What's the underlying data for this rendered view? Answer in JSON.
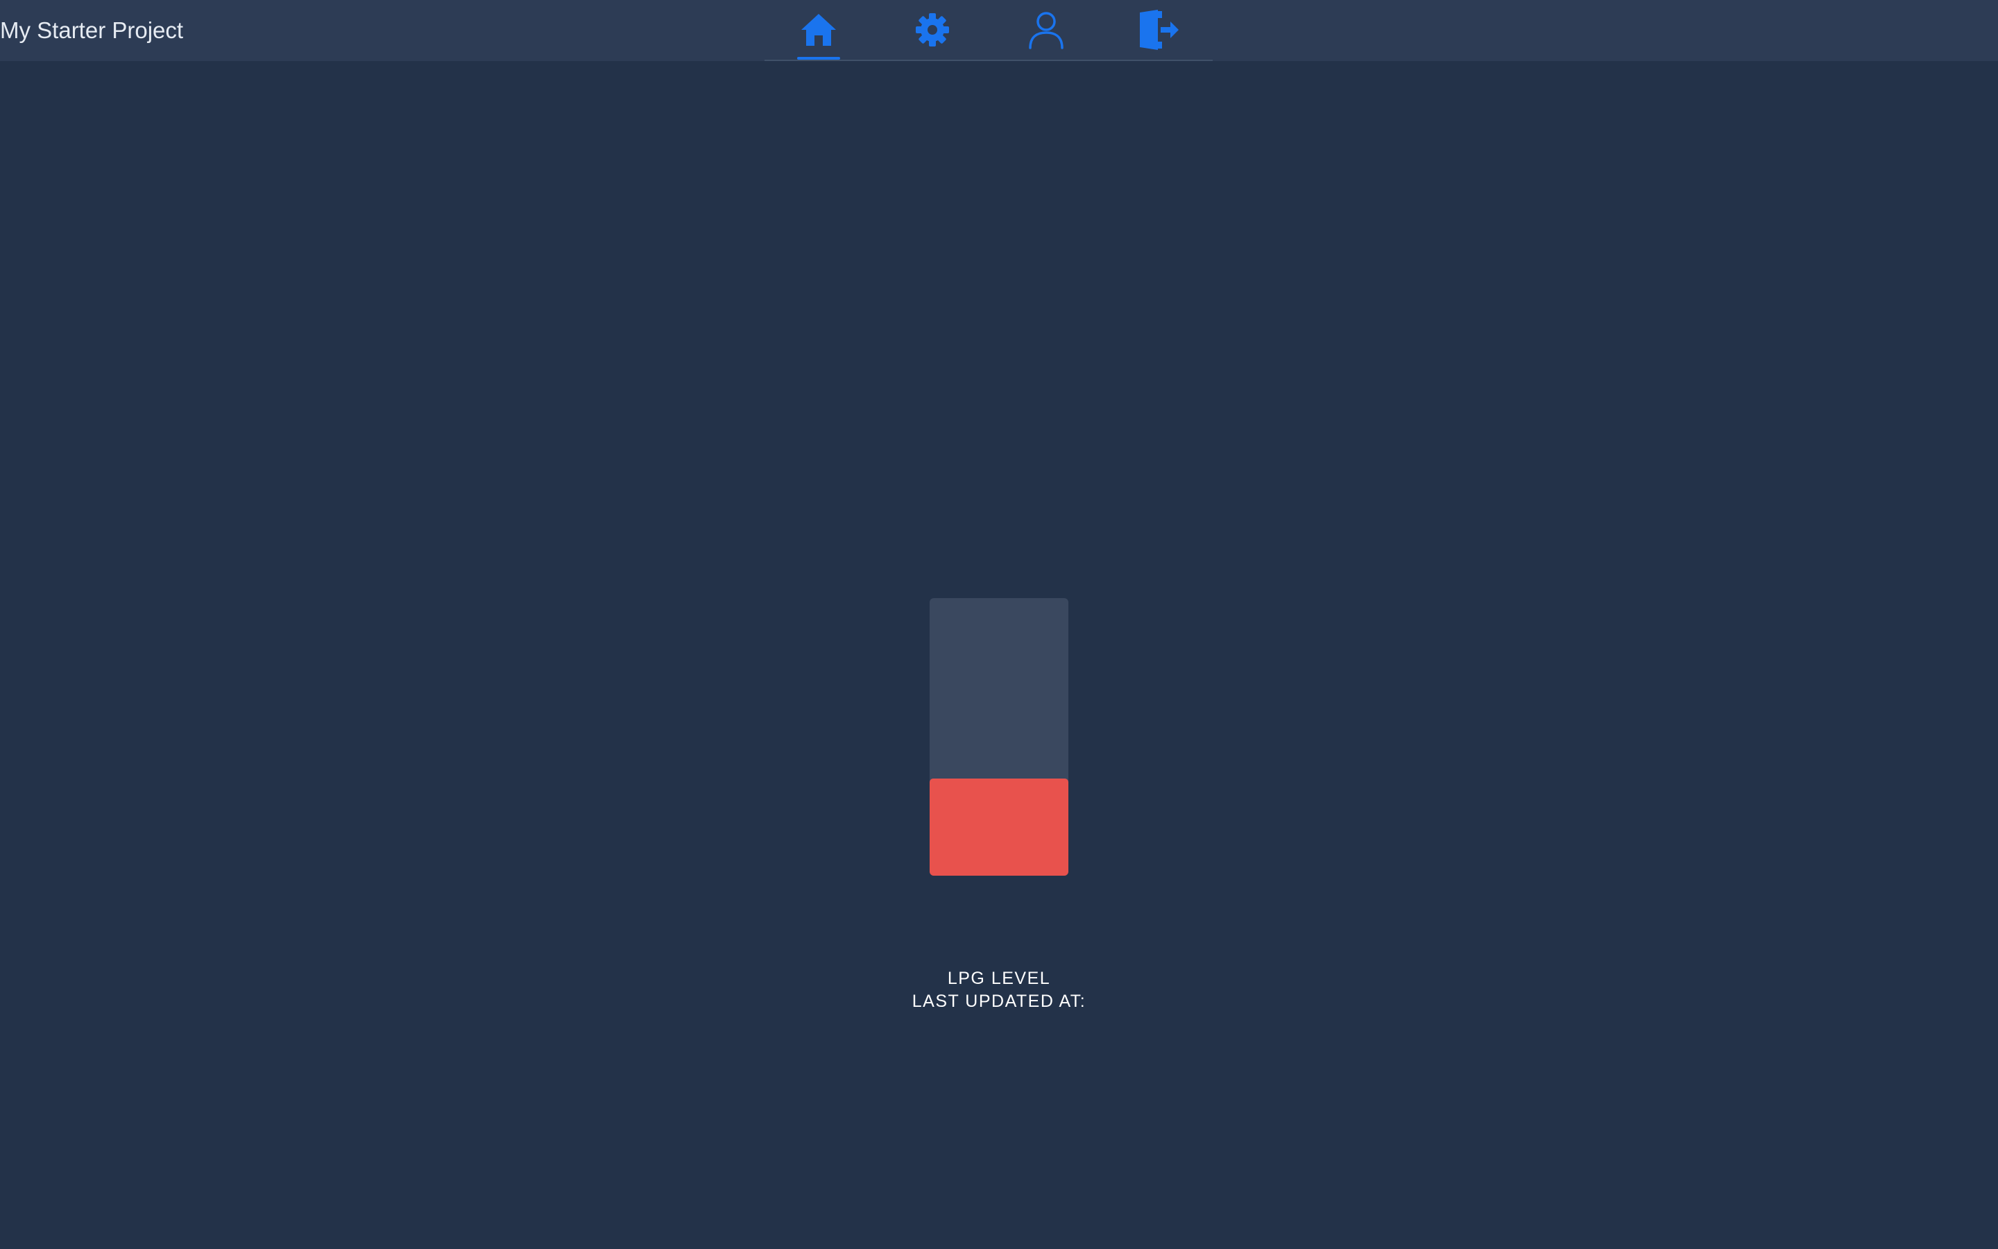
{
  "app": {
    "title": "My Starter Project"
  },
  "nav": {
    "active_tab": "home",
    "tabs": [
      {
        "id": "home",
        "icon": "home-icon"
      },
      {
        "id": "settings",
        "icon": "gear-icon"
      },
      {
        "id": "profile",
        "icon": "user-icon"
      },
      {
        "id": "logout",
        "icon": "logout-icon"
      }
    ]
  },
  "gauge": {
    "level_fraction": 0.35,
    "fill_color": "#e8524d",
    "empty_color": "#3a485f"
  },
  "status": {
    "label": "LPG LEVEL",
    "last_updated_label": "LAST UPDATED AT:"
  },
  "colors": {
    "background": "#233249",
    "topbar": "#2d3c55",
    "accent": "#1a74ee"
  }
}
